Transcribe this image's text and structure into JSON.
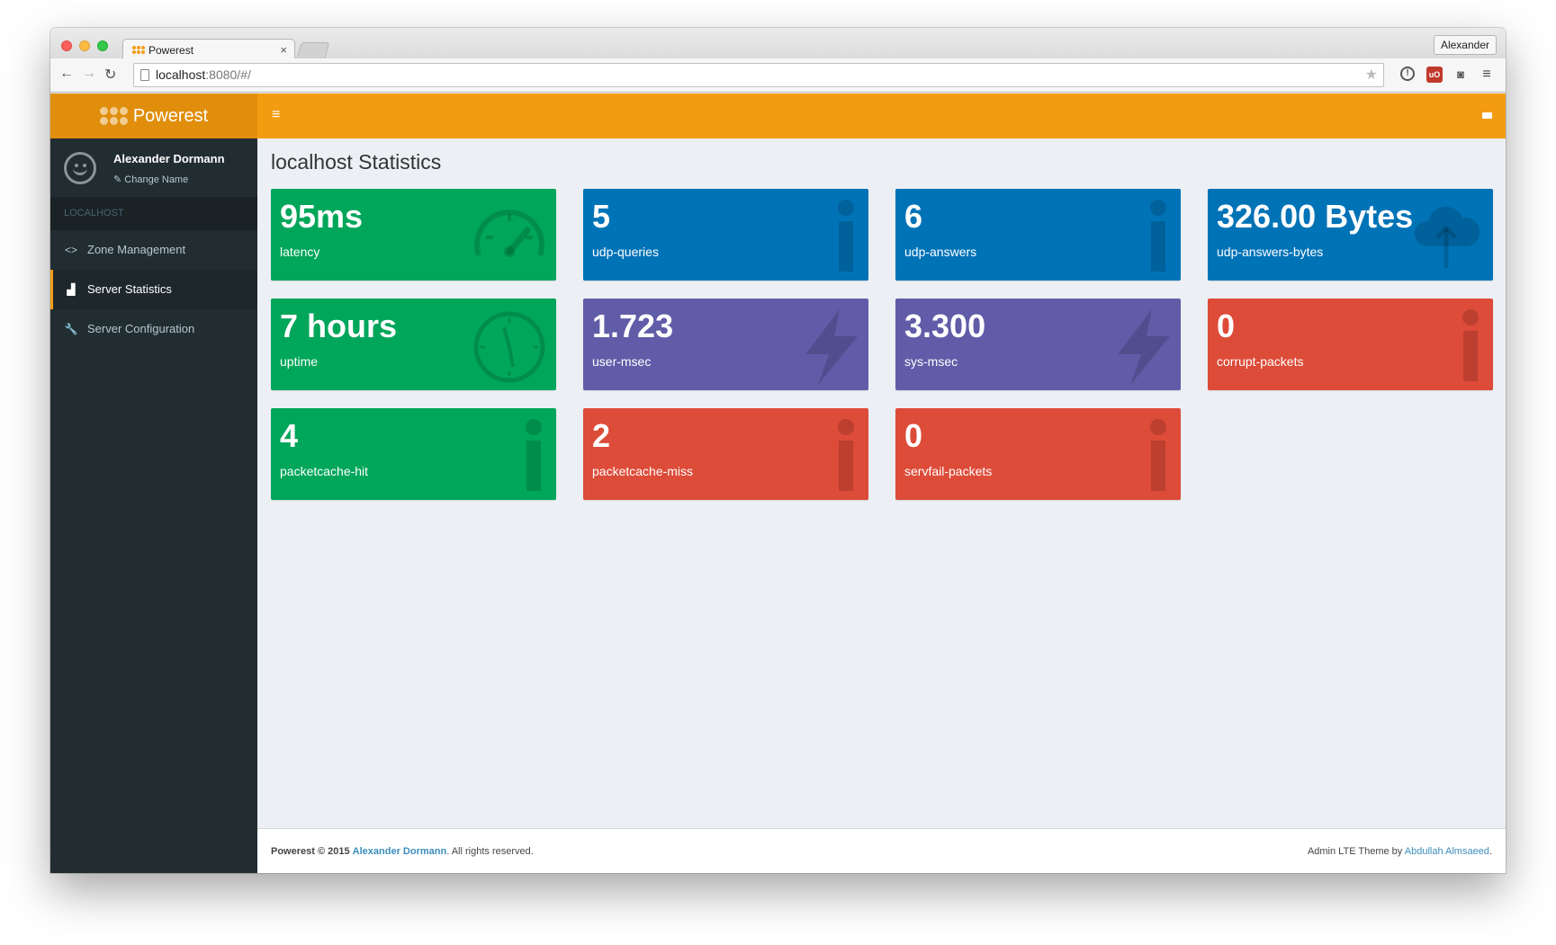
{
  "browser": {
    "tab_title": "Powerest",
    "tab_close": "×",
    "profile": "Alexander",
    "url_host": "localhost",
    "url_rest": ":8080/#/"
  },
  "app": {
    "brand": "Powerest",
    "user": {
      "name": "Alexander Dormann",
      "change_name": "Change Name"
    },
    "sidebar": {
      "section": "LOCALHOST",
      "items": [
        {
          "label": "Zone Management",
          "icon": "code-icon",
          "active": false
        },
        {
          "label": "Server Statistics",
          "icon": "bar-chart-icon",
          "active": true
        },
        {
          "label": "Server Configuration",
          "icon": "wrench-icon",
          "active": false
        }
      ]
    },
    "page_title": "localhost Statistics",
    "stats": [
      {
        "value": "95ms",
        "label": "latency",
        "color": "#00a65a",
        "icon": "dashboard-icon"
      },
      {
        "value": "5",
        "label": "udp-queries",
        "color": "#0073b7",
        "icon": "info-icon"
      },
      {
        "value": "6",
        "label": "udp-answers",
        "color": "#0073b7",
        "icon": "info-icon"
      },
      {
        "value": "326.00 Bytes",
        "label": "udp-answers-bytes",
        "color": "#0073b7",
        "icon": "cloud-upload-icon"
      },
      {
        "value": "7 hours",
        "label": "uptime",
        "color": "#00a65a",
        "icon": "clock-icon"
      },
      {
        "value": "1.723",
        "label": "user-msec",
        "color": "#605ca8",
        "icon": "bolt-icon"
      },
      {
        "value": "3.300",
        "label": "sys-msec",
        "color": "#605ca8",
        "icon": "bolt-icon"
      },
      {
        "value": "0",
        "label": "corrupt-packets",
        "color": "#dd4b39",
        "icon": "info-icon"
      },
      {
        "value": "4",
        "label": "packetcache-hit",
        "color": "#00a65a",
        "icon": "info-icon"
      },
      {
        "value": "2",
        "label": "packetcache-miss",
        "color": "#dd4b39",
        "icon": "info-icon"
      },
      {
        "value": "0",
        "label": "servfail-packets",
        "color": "#dd4b39",
        "icon": "info-icon"
      }
    ],
    "footer": {
      "left_prefix": "Powerest © 2015",
      "left_author": "Alexander Dormann",
      "left_suffix": ". All rights reserved.",
      "right_prefix": "Admin LTE Theme by ",
      "right_author": "Abdullah Almsaeed",
      "right_suffix": "."
    }
  }
}
